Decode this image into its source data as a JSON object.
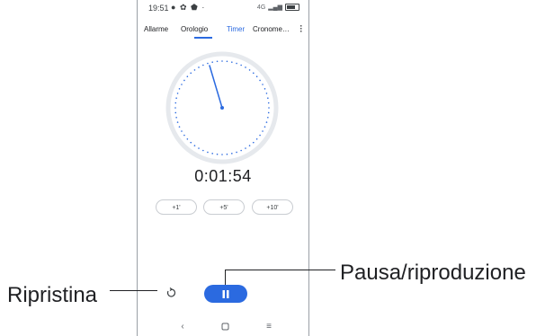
{
  "status_bar": {
    "time": "19:51",
    "icons": [
      "notification-icon",
      "settings-icon",
      "shield-icon",
      "dot-icon"
    ],
    "network": "4G",
    "signal": "signal-icon",
    "battery": "battery-icon"
  },
  "tabs": [
    {
      "label": "Allarme",
      "active": false
    },
    {
      "label": "Orologio",
      "active": false
    },
    {
      "label": "Timer",
      "active": true
    },
    {
      "label": "Cronome…",
      "active": false
    }
  ],
  "timer": {
    "readout": "0:01:54"
  },
  "quick_add": [
    {
      "label": "+1'"
    },
    {
      "label": "+5'"
    },
    {
      "label": "+10'"
    }
  ],
  "controls": {
    "reset_icon": "reset-icon",
    "play_pause_icon": "pause-icon"
  },
  "nav": {
    "back_icon": "back-icon",
    "home_icon": "home-icon",
    "recents_icon": "recents-icon"
  },
  "callouts": {
    "reset": "Ripristina",
    "play_pause": "Pausa/riproduzione"
  },
  "colors": {
    "accent": "#2b6ae0",
    "dial_ring": "#e3e6ea",
    "text": "#202124"
  }
}
